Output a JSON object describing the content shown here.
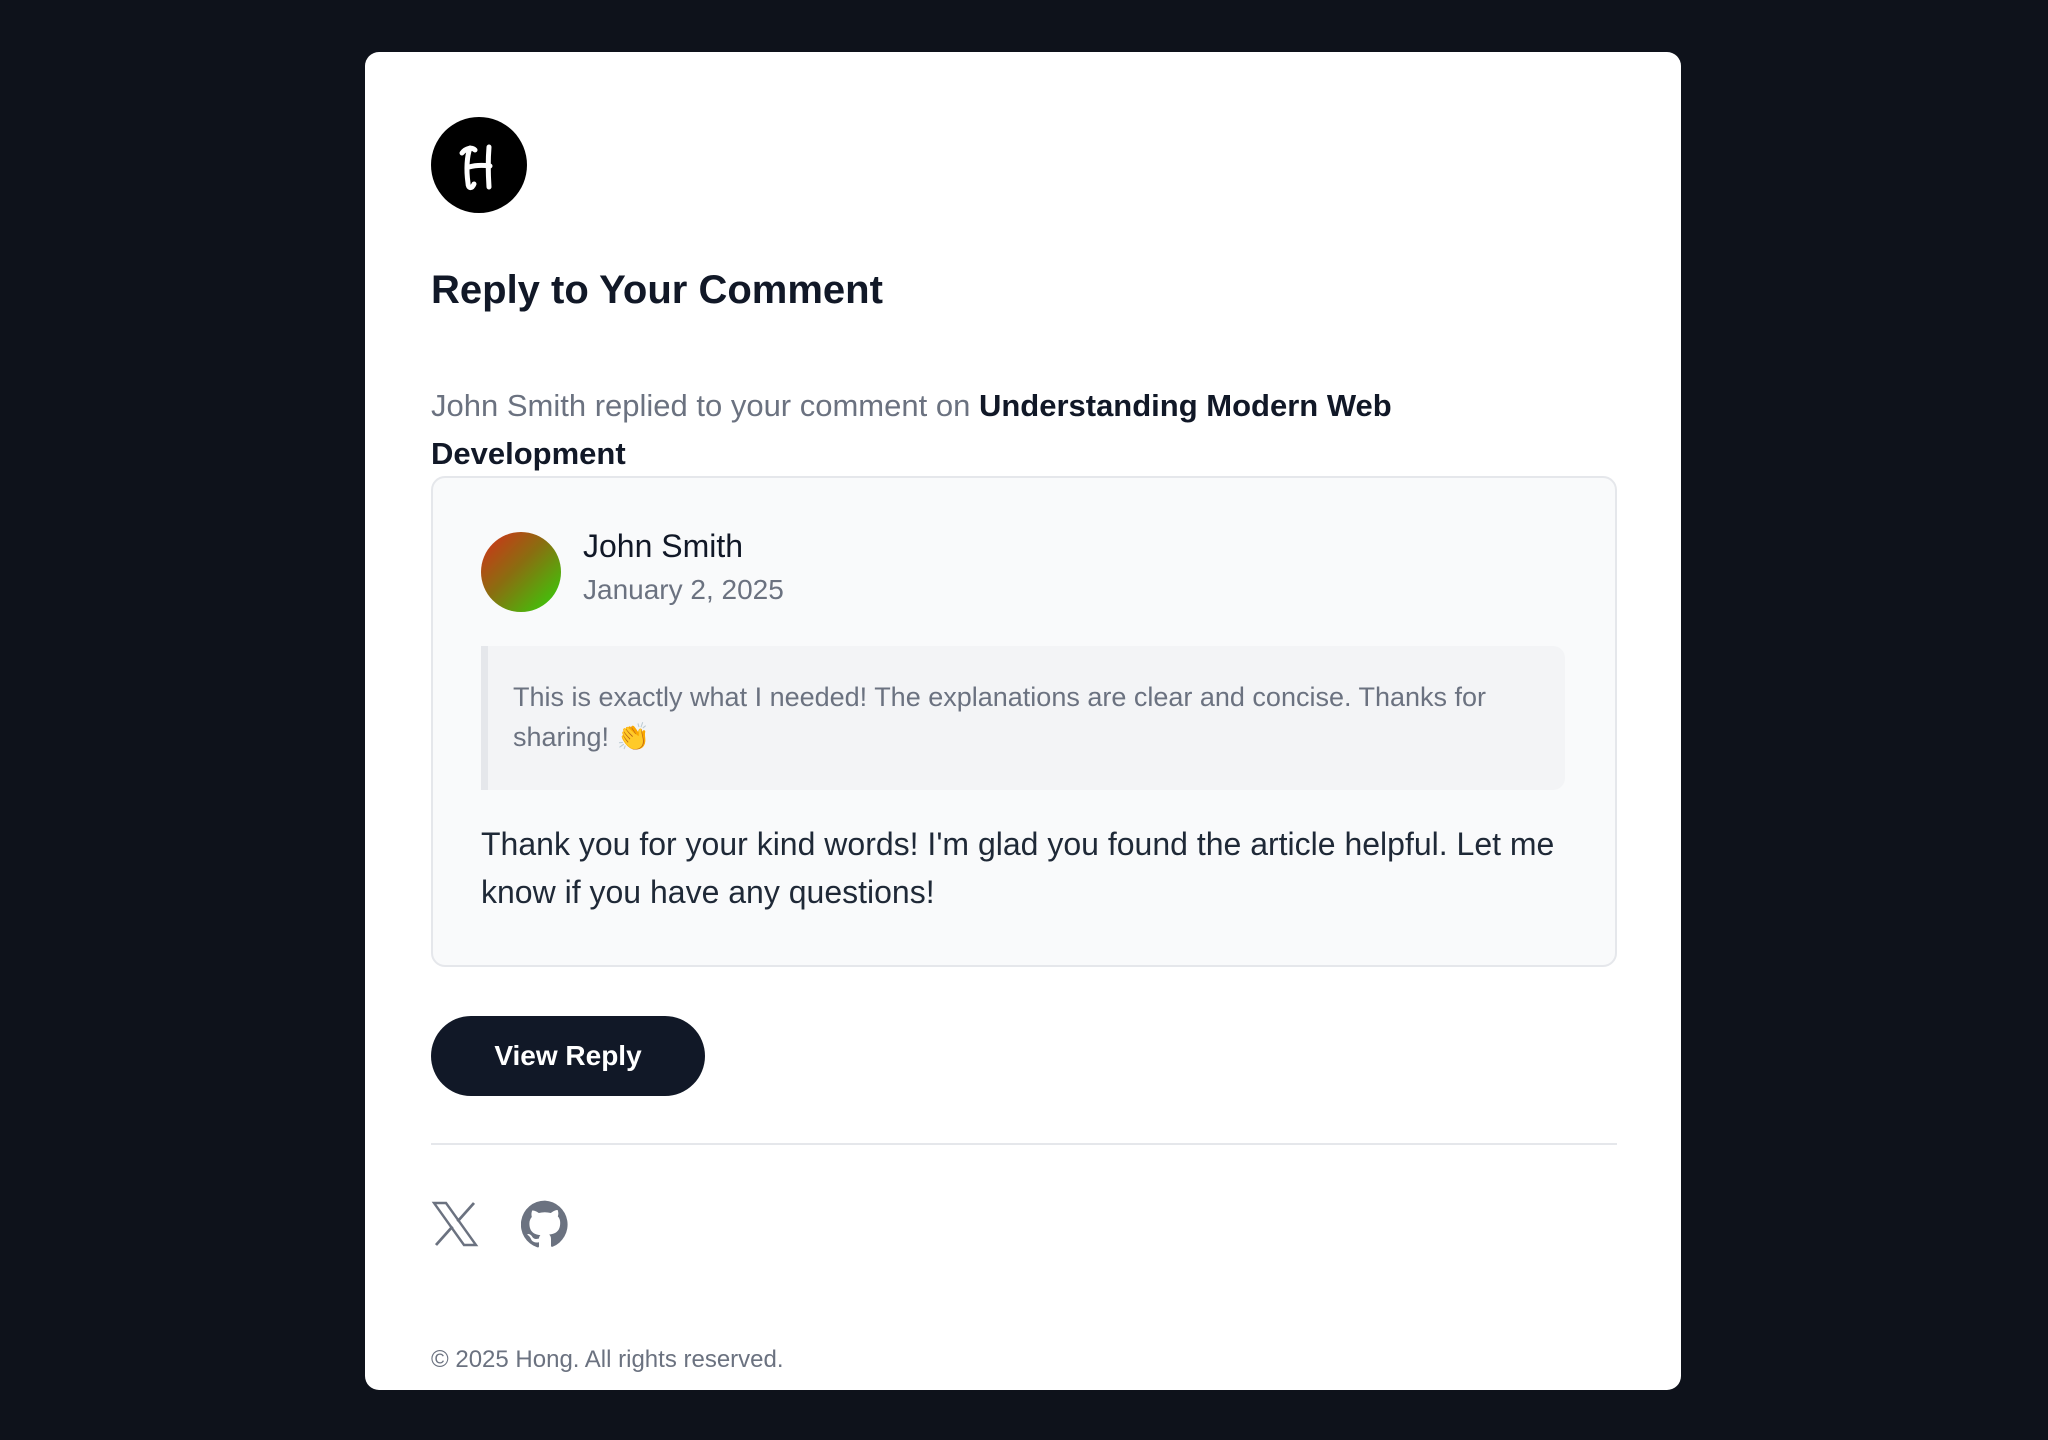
{
  "logo": {
    "icon": "h-monogram-icon",
    "letter": "H"
  },
  "header": {
    "title": "Reply to Your Comment",
    "intro_prefix": "John Smith replied to your comment on ",
    "post_title": "Understanding Modern Web Development"
  },
  "comment": {
    "author": "John Smith",
    "date": "January 2, 2025",
    "avatar_colors": [
      "#d62d1a",
      "#2fd60a"
    ],
    "original_comment": "This is exactly what I needed! The explanations are clear and concise. Thanks for sharing! 👏",
    "reply": "Thank you for your kind words! I'm glad you found the article helpful. Let me know if you have any questions!"
  },
  "actions": {
    "view_reply_label": "View Reply"
  },
  "footer": {
    "social": [
      {
        "icon": "x-logo-icon"
      },
      {
        "icon": "github-icon"
      }
    ],
    "copyright": "© 2025 Hong. All rights reserved."
  },
  "colors": {
    "page_bg": "#0e121b",
    "card_bg": "#ffffff",
    "primary": "#111827",
    "muted_text": "#6b7280",
    "comment_bg": "#f9fafb",
    "quote_bg": "#f3f4f6",
    "border": "#e5e7eb"
  }
}
